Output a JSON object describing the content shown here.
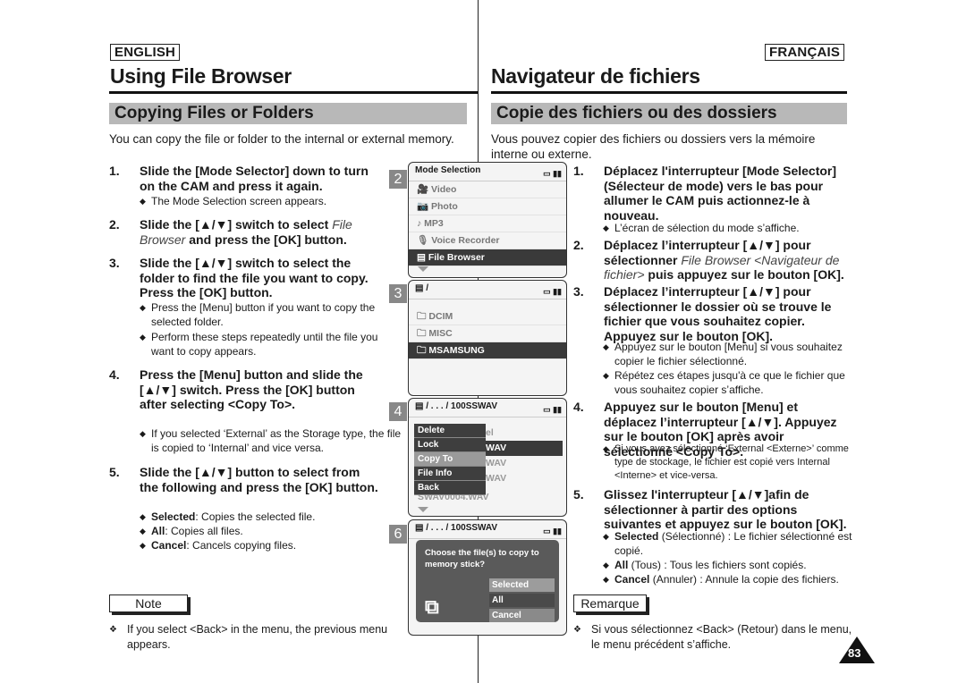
{
  "header": {
    "lang_en": "ENGLISH",
    "lang_fr": "FRANÇAIS",
    "title_en": "Using File Browser",
    "title_fr": "Navigateur de fichiers",
    "section_en": "Copying Files or Folders",
    "section_fr": "Copie des fichiers ou des dossiers",
    "intro_en": "You can copy the file or folder to the internal or external memory.",
    "intro_fr": "Vous pouvez copier des fichiers ou dossiers vers la mémoire interne ou externe."
  },
  "steps_en": [
    {
      "num": "1.",
      "text": "Slide the [Mode Selector] down to turn on the CAM and press it again.",
      "bullets": [
        "The Mode Selection screen appears."
      ]
    },
    {
      "num": "2.",
      "text_a": "Slide the [▲/▼] switch to select ",
      "text_it": "File Browser",
      "text_b": " and press the [OK] button."
    },
    {
      "num": "3.",
      "text": "Slide the [▲/▼] switch to select the folder to find the file you want to copy. Press the [OK] button.",
      "bullets": [
        "Press the [Menu] button if you want to copy the selected folder.",
        "Perform these steps repeatedly until the file you want to copy appears."
      ]
    },
    {
      "num": "4.",
      "text": "Press the [Menu] button and slide the [▲/▼] switch. Press the [OK] button after selecting <Copy To>.",
      "bullets": [
        "If you selected ‘External’ as the Storage type, the file is copied to ‘Internal’ and vice versa."
      ]
    },
    {
      "num": "5.",
      "text": "Slide the [▲/▼] button to select from the following and press the [OK] button.",
      "options": [
        {
          "term": "Selected",
          "desc": ": Copies the selected file."
        },
        {
          "term": "All",
          "desc": ": Copies all files."
        },
        {
          "term": "Cancel",
          "desc": ": Cancels copying files."
        }
      ]
    }
  ],
  "steps_fr": [
    {
      "num": "1.",
      "text": "Déplacez l'interrupteur [Mode Selector] (Sélecteur de mode) vers le bas pour allumer le CAM puis actionnez-le à nouveau.",
      "bullets": [
        "L’écran de sélection du mode s’affiche."
      ]
    },
    {
      "num": "2.",
      "text_a": "Déplacez l’interrupteur [▲/▼] pour sélectionner ",
      "text_it": "File Browser <Navigateur de fichier>",
      "text_b": " puis appuyez sur le bouton [OK]."
    },
    {
      "num": "3.",
      "text": "Déplacez l’interrupteur [▲/▼] pour sélectionner le dossier où se trouve le fichier que vous souhaitez copier. Appuyez sur le bouton [OK].",
      "bullets": [
        "Appuyez sur le bouton [Menu] si vous souhaitez copier le fichier sélectionné.",
        "Répétez ces étapes jusqu'à ce que le fichier que vous souhaitez copier s’affiche."
      ]
    },
    {
      "num": "4.",
      "text": "Appuyez sur le bouton [Menu] et déplacez l’interrupteur [▲/▼]. Appuyez sur le bouton [OK] après avoir sélectionné <Copy To>.",
      "bullets": [
        "Si vous avez sélectionné ‘External <Externe>’ comme type de stockage, le fichier est copié vers Internal <Interne> et vice-versa."
      ]
    },
    {
      "num": "5.",
      "text": "Glissez l'interrupteur [▲/▼]afin de sélectionner à partir des options suivantes et appuyez sur le bouton [OK].",
      "options": [
        {
          "term": "Selected",
          "desc": " (Sélectionné) : Le fichier sélectionné est copié."
        },
        {
          "term": "All",
          "desc": " (Tous) : Tous les fichiers sont copiés."
        },
        {
          "term": "Cancel",
          "desc": " (Annuler) : Annule la copie des fichiers."
        }
      ]
    }
  ],
  "screens": {
    "s2": {
      "badge": "2",
      "title": "Mode Selection",
      "items": [
        "Video",
        "Photo",
        "MP3",
        "Voice Recorder",
        "File Browser"
      ],
      "selected": "File Browser"
    },
    "s3": {
      "badge": "3",
      "path": "/",
      "items": [
        "DCIM",
        "MISC",
        "MSAMSUNG"
      ],
      "selected": "MSAMSUNG"
    },
    "s4": {
      "badge": "4",
      "path": "/ . . . / 100SSWAV",
      "menu": [
        "Delete",
        "Lock",
        "Copy To",
        "File Info",
        "Back"
      ],
      "highlighted": "Copy To",
      "behind": [
        "el",
        "WAV",
        "WAV",
        "WAV",
        "SWAV0004.WAV"
      ]
    },
    "s6": {
      "badge": "6",
      "path": "/ . . . / 100SSWAV",
      "question": "Choose the file(s) to copy to memory stick?",
      "options": [
        "Selected",
        "All",
        "Cancel"
      ],
      "highlighted": "Selected"
    }
  },
  "notes": {
    "label_en": "Note",
    "text_en": "If you select <Back> in the menu, the previous menu appears.",
    "label_fr": "Remarque",
    "text_fr": "Si vous sélectionnez <Back> (Retour) dans le menu, le menu précédent s’affiche."
  },
  "page_number": "83"
}
